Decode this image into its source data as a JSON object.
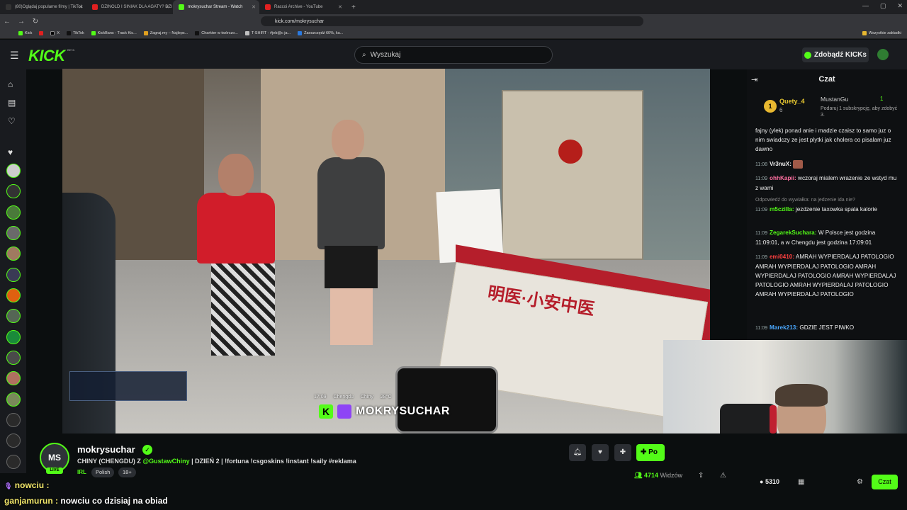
{
  "browser": {
    "tabs": [
      {
        "label": "(80)Oglądaj popularne filmy | TikTok",
        "color": "#333"
      },
      {
        "label": "DZINOLD I SINIAK DLA AGATY? DZI",
        "color": "#e02020"
      },
      {
        "label": "mokrysuchar Stream - Watch",
        "color": "#53fc18"
      },
      {
        "label": "Raccoi Archive - YouTube",
        "color": "#e02020"
      }
    ],
    "url": "kick.com/mokrysuchar",
    "bookmarks": [
      "Kick",
      "X",
      "TikTok",
      "KickBans - Track Kic...",
      "Zagraj.my – Najleps...",
      "Charkter w twórczo...",
      "T-SHIRT - #jeb@c ja...",
      "Zaoszczędź 60%, ku..."
    ],
    "all_bookmarks": "Wszystkie zakładki"
  },
  "header": {
    "logo": "KICK",
    "beta": "BETA",
    "search_placeholder": "Wyszukaj",
    "kicks_button": "Zdobądź KICKs"
  },
  "video": {
    "hud_time": "17:09",
    "hud_city": "Chengdu",
    "hud_country": "Chiny",
    "hud_temp": "28°C",
    "watermark_name": "MOKRYSUCHAR",
    "banner_text": "明医·小安中医"
  },
  "chat": {
    "title": "Czat",
    "pinned": {
      "user1": "Quety_4",
      "count1": "6",
      "user2": "MustanGu",
      "count2": "1",
      "gift_text": "Podaruj 1 subskrypcję, aby zdobyć 3."
    },
    "messages": [
      {
        "time": "",
        "user": "",
        "text": "fajny (ylek) ponad anie i madzie czaisz to samo juz o nim swiadczy ze jest plytki jak cholera co pisalam juz dawno",
        "color": "#eee"
      },
      {
        "time": "11:08",
        "user": "Vr3nuX:",
        "text": "",
        "color": "#fff"
      },
      {
        "time": "11:09",
        "user": "ohhKapii:",
        "text": "wczoraj mialem wrazenie ze wstyd mu z wami",
        "color": "#ff6fa0"
      },
      {
        "time": "",
        "user": "",
        "text": "Odpowiedź do wywiałka: na jedzenie ida nie?",
        "color": "#888"
      },
      {
        "time": "11:09",
        "user": "m5czilla:",
        "text": "jezdzenie taxowka spala kalorie",
        "color": "#53fc18"
      },
      {
        "time": "11:09",
        "user": "ZegarekSuchara:",
        "text": "W Polsce jest godzina 11:09:01, a w Chengdu jest godzina 17:09:01",
        "color": "#53fc18"
      },
      {
        "time": "11:09",
        "user": "emi0410:",
        "text": "AMRAH WYPIERDALAJ PATOLOGIO AMRAH WYPIERDALAJ PATOLOGIO AMRAH WYPIERDALAJ PATOLOGIO AMRAH WYPIERDALAJ PATOLOGIO AMRAH WYPIERDALAJ PATOLOGIO AMRAH WYPIERDALAJ PATOLOGIO",
        "color": "#ff4040"
      },
      {
        "time": "11:09",
        "user": "Marek213:",
        "text": "GDZIE JEST PIWKO",
        "color": "#4aa8ff"
      }
    ]
  },
  "stream": {
    "channel": "mokrysuchar",
    "avatar": "MS",
    "live": "LIVE",
    "title_pre": "CHINY (CHENGDU) Z ",
    "title_mention": "@GustawChiny",
    "title_post": " | DZIEŃ 2 | !fortuna !csgoskins !instant !saily #reklama",
    "category": "IRL",
    "tags": [
      "Polish",
      "18+"
    ],
    "follow": "Po",
    "viewers": "4714",
    "viewers_label": "Widzów",
    "balance": "5310",
    "chat_button": "Czat"
  },
  "overlay": {
    "line1_user": "nowciu :",
    "line2_user": "ganjamurun :",
    "line2_text": "nowciu co dzisiaj na obiad"
  }
}
